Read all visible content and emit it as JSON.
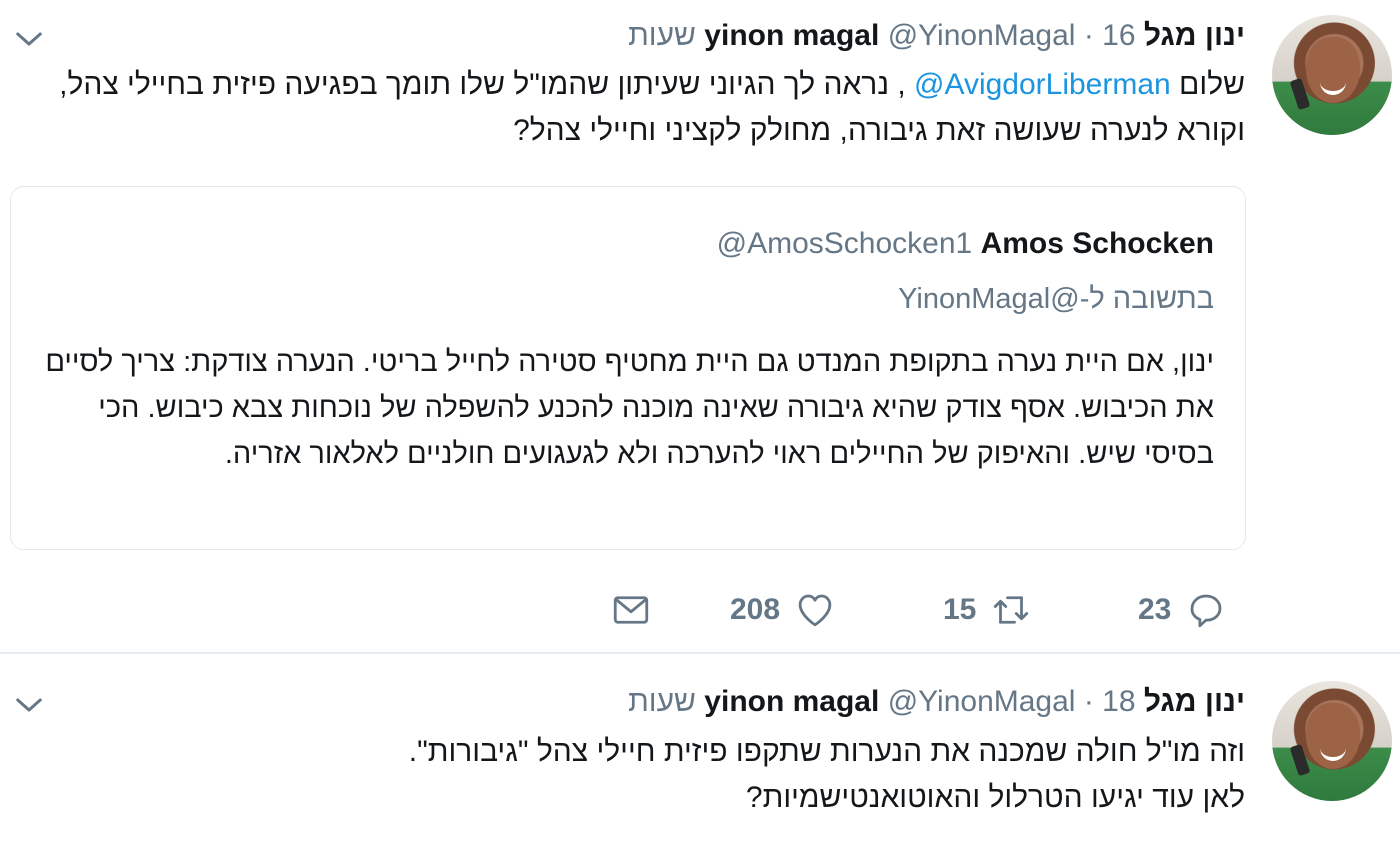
{
  "tweets": [
    {
      "author_name": "ינון מגל yinon magal",
      "handle": "@YinonMagal",
      "separator": "·",
      "time": "16 שעות",
      "text_before": "שלום ",
      "mention": "@AvigdorLiberman",
      "text_after": " , נראה לך הגיוני שעיתון שהמו\"ל שלו תומך בפגיעה פיזית בחיילי צהל, וקורא לנערה שעושה זאת גיבורה, מחולק לקציני וחיילי צהל?",
      "quoted": {
        "name": "Amos Schocken",
        "handle": "@AmosSchocken1",
        "reply_to": "בתשובה ל-@YinonMagal",
        "text": "ינון, אם היית נערה בתקופת המנדט גם היית מחטיף סטירה לחייל בריטי. הנערה צודקת: צריך לסיים את הכיבוש. אסף צודק שהיא גיבורה שאינה מוכנה להכנע להשפלה של נוכחות צבא כיבוש. הכי בסיסי שיש. והאיפוק של החיילים ראוי להערכה ולא לגעגועים חולניים לאלאור אזריה."
      },
      "actions": {
        "replies": "23",
        "retweets": "15",
        "likes": "208"
      }
    },
    {
      "author_name": "ינון מגל yinon magal",
      "handle": "@YinonMagal",
      "separator": "·",
      "time": "18 שעות",
      "line1": "וזה מו\"ל חולה שמכנה את הנערות שתקפו פיזית חיילי צהל \"גיבורות\".",
      "line2": "לאן עוד יגיעו הטרלול והאוטואנטישמיות?"
    }
  ],
  "icons": {
    "reply": "reply-icon",
    "retweet": "retweet-icon",
    "like": "heart-icon",
    "message": "envelope-icon",
    "menu": "chevron-down-icon"
  },
  "colors": {
    "link": "#1b95e0",
    "muted": "#657786",
    "border": "#e1e8ed"
  }
}
